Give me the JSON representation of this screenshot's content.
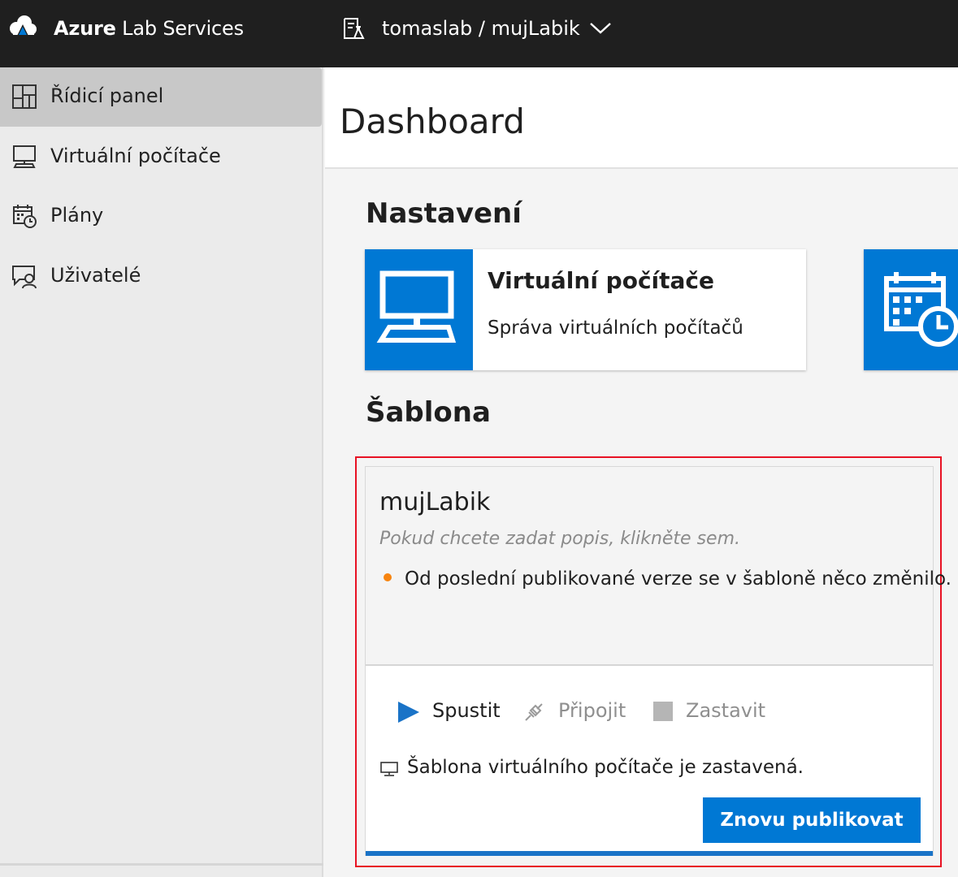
{
  "app": {
    "brand_bold": "Azure",
    "brand_rest": " Lab Services",
    "lab_selector": "tomaslab / mujLabik"
  },
  "sidebar": {
    "items": [
      {
        "label": "Řídicí panel",
        "icon": "dashboard-icon",
        "active": true
      },
      {
        "label": "Virtuální počítače",
        "icon": "monitor-icon",
        "active": false
      },
      {
        "label": "Plány",
        "icon": "calendar-clock-icon",
        "active": false
      },
      {
        "label": "Uživatelé",
        "icon": "users-chat-icon",
        "active": false
      }
    ]
  },
  "main": {
    "title": "Dashboard",
    "settings": {
      "heading": "Nastavení",
      "tiles": [
        {
          "title": "Virtuální počítače",
          "description": "Správa virtuálních počítačů",
          "icon": "monitor-icon"
        },
        {
          "title": "",
          "description": "",
          "icon": "calendar-clock-icon"
        }
      ]
    },
    "template": {
      "heading": "Šablona",
      "name": "mujLabik",
      "description_placeholder": "Pokud chcete zadat popis, klikněte sem.",
      "warning": "Od poslední publikované verze se v šabloně něco změnilo.",
      "actions": {
        "start": "Spustit",
        "connect": "Připojit",
        "stop": "Zastavit"
      },
      "status": "Šablona virtuálního počítače je zastavená.",
      "publish_label": "Znovu publikovat"
    }
  },
  "colors": {
    "accent": "#0078d4",
    "topbar": "#1f1f1f",
    "warning_dot": "#f7840f",
    "highlight_border": "#e81123"
  }
}
